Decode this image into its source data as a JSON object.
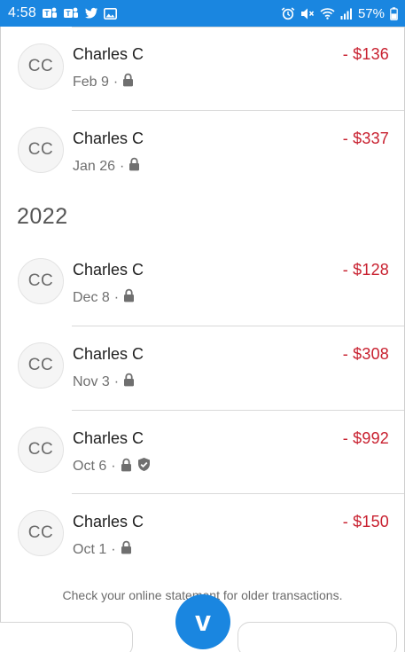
{
  "status_bar": {
    "time": "4:58",
    "battery_percent": "57%",
    "icons_left": [
      "teams-icon",
      "teams-icon",
      "twitter-icon",
      "gallery-icon"
    ],
    "icons_right": [
      "alarm-icon",
      "mute-icon",
      "wifi-icon",
      "signal-icon",
      "battery-icon"
    ],
    "color": "#1a86e0"
  },
  "transactions_2023": [
    {
      "initials": "CC",
      "name": "Charles C",
      "date": "Feb 9",
      "amount": "- $136",
      "icons": [
        "lock-icon"
      ]
    },
    {
      "initials": "CC",
      "name": "Charles C",
      "date": "Jan 26",
      "amount": "- $337",
      "icons": [
        "lock-icon"
      ]
    }
  ],
  "year_header": "2022",
  "transactions_2022": [
    {
      "initials": "CC",
      "name": "Charles C",
      "date": "Dec 8",
      "amount": "- $128",
      "icons": [
        "lock-icon"
      ]
    },
    {
      "initials": "CC",
      "name": "Charles C",
      "date": "Nov 3",
      "amount": "- $308",
      "icons": [
        "lock-icon"
      ]
    },
    {
      "initials": "CC",
      "name": "Charles C",
      "date": "Oct 6",
      "amount": "- $992",
      "icons": [
        "lock-icon",
        "shield-icon"
      ]
    },
    {
      "initials": "CC",
      "name": "Charles C",
      "date": "Oct 1",
      "amount": "- $150",
      "icons": [
        "lock-icon"
      ]
    }
  ],
  "footer_note": "Check your online statement for older transactions.",
  "fab": {
    "label": "v",
    "icon": "venmo-logo-icon"
  },
  "colors": {
    "amount_negative": "#c8202f",
    "accent": "#1a86e0"
  },
  "separator": "·"
}
